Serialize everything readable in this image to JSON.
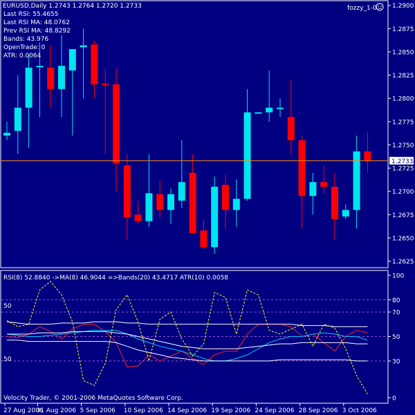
{
  "colors": {
    "background": "#000080",
    "frame": "#ffffff",
    "bull": "#00e5ee",
    "bear": "#ff0000",
    "price_line": "#ff8c1a",
    "rsi": "#ff2020",
    "ma": "#00c8ff",
    "bands": "#ffffff",
    "atr": "#ffff00",
    "levels": "#9a4fd6"
  },
  "header": {
    "symbol_line": "EURUSD,Daily   1.2743 1.2764 1.2720 1.2733",
    "expert_name": "fozzy_1-0",
    "info_lines": [
      "Last RSI: 55.4655",
      "Last RSI MA: 48.0762",
      "Prev RSI MA: 48.8292",
      "Bands: 43.976",
      "OpenTrade: 0",
      "ATR: 0.0064"
    ],
    "current_price_label": "1.2733"
  },
  "indicator": {
    "title": "RSI(8) 52.8840 ->MA(8) 46.9044 =>Bands(20) 43.4717  ATR(10) 0.0058",
    "left_labels": [
      "50",
      "50"
    ],
    "axis_ticks": [
      "100",
      "80",
      "70",
      "50",
      "30",
      "0"
    ]
  },
  "footer": {
    "copyright": "Velocity Trader, © 2001-2006 MetaQuotes Software Corp."
  },
  "chart_data": [
    {
      "type": "candlestick",
      "ylim": [
        1.2618,
        1.2905
      ],
      "y_ticks": [
        "1.2900",
        "1.2875",
        "1.2850",
        "1.2825",
        "1.2800",
        "1.2775",
        "1.2750",
        "1.2725",
        "1.2700",
        "1.2675",
        "1.2650",
        "1.2625"
      ],
      "x_tick_labels": [
        "27 Aug 2006",
        "31 Aug 2006",
        "5 Sep 2006",
        "10 Sep 2006",
        "14 Sep 2006",
        "19 Sep 2006",
        "24 Sep 2006",
        "28 Sep 2006",
        "3 Oct 2006"
      ],
      "current_price": 1.2733,
      "candles": [
        {
          "o": 1.276,
          "h": 1.2775,
          "l": 1.2755,
          "c": 1.2763
        },
        {
          "o": 1.2765,
          "h": 1.2825,
          "l": 1.274,
          "c": 1.279
        },
        {
          "o": 1.279,
          "h": 1.2847,
          "l": 1.2747,
          "c": 1.2833
        },
        {
          "o": 1.2835,
          "h": 1.286,
          "l": 1.278,
          "c": 1.2835
        },
        {
          "o": 1.2833,
          "h": 1.2857,
          "l": 1.279,
          "c": 1.281
        },
        {
          "o": 1.281,
          "h": 1.2868,
          "l": 1.278,
          "c": 1.2835
        },
        {
          "o": 1.283,
          "h": 1.285,
          "l": 1.276,
          "c": 1.2853
        },
        {
          "o": 1.2855,
          "h": 1.2875,
          "l": 1.28,
          "c": 1.2857
        },
        {
          "o": 1.2858,
          "h": 1.2862,
          "l": 1.28,
          "c": 1.2815
        },
        {
          "o": 1.2816,
          "h": 1.2832,
          "l": 1.274,
          "c": 1.2815
        },
        {
          "o": 1.2815,
          "h": 1.2832,
          "l": 1.27,
          "c": 1.273
        },
        {
          "o": 1.2728,
          "h": 1.274,
          "l": 1.2648,
          "c": 1.2672
        },
        {
          "o": 1.2675,
          "h": 1.269,
          "l": 1.2665,
          "c": 1.2668
        },
        {
          "o": 1.2668,
          "h": 1.274,
          "l": 1.2662,
          "c": 1.2698
        },
        {
          "o": 1.2697,
          "h": 1.2712,
          "l": 1.2672,
          "c": 1.268
        },
        {
          "o": 1.268,
          "h": 1.2703,
          "l": 1.2665,
          "c": 1.2697
        },
        {
          "o": 1.269,
          "h": 1.2755,
          "l": 1.2682,
          "c": 1.271
        },
        {
          "o": 1.272,
          "h": 1.274,
          "l": 1.2658,
          "c": 1.2655
        },
        {
          "o": 1.2658,
          "h": 1.267,
          "l": 1.2638,
          "c": 1.264
        },
        {
          "o": 1.264,
          "h": 1.2716,
          "l": 1.2633,
          "c": 1.2705
        },
        {
          "o": 1.2707,
          "h": 1.2718,
          "l": 1.266,
          "c": 1.268
        },
        {
          "o": 1.268,
          "h": 1.2713,
          "l": 1.2662,
          "c": 1.2692
        },
        {
          "o": 1.2692,
          "h": 1.281,
          "l": 1.269,
          "c": 1.2785
        },
        {
          "o": 1.2785,
          "h": 1.2785,
          "l": 1.2785,
          "c": 1.2785
        },
        {
          "o": 1.2785,
          "h": 1.283,
          "l": 1.2775,
          "c": 1.279
        },
        {
          "o": 1.279,
          "h": 1.28,
          "l": 1.278,
          "c": 1.279
        },
        {
          "o": 1.278,
          "h": 1.282,
          "l": 1.274,
          "c": 1.2755
        },
        {
          "o": 1.2755,
          "h": 1.276,
          "l": 1.266,
          "c": 1.2695
        },
        {
          "o": 1.2695,
          "h": 1.272,
          "l": 1.2675,
          "c": 1.271
        },
        {
          "o": 1.271,
          "h": 1.2728,
          "l": 1.2698,
          "c": 1.2705
        },
        {
          "o": 1.2705,
          "h": 1.272,
          "l": 1.2648,
          "c": 1.267
        },
        {
          "o": 1.2673,
          "h": 1.2686,
          "l": 1.267,
          "c": 1.268
        },
        {
          "o": 1.268,
          "h": 1.276,
          "l": 1.266,
          "c": 1.2743
        },
        {
          "o": 1.2743,
          "h": 1.2764,
          "l": 1.272,
          "c": 1.2733
        }
      ]
    },
    {
      "type": "line",
      "ylim": [
        0,
        100
      ],
      "levels": [
        80,
        70,
        50,
        30
      ],
      "series": [
        {
          "name": "RSI(8)",
          "values": [
            50,
            49,
            52,
            58,
            54,
            48,
            56,
            60,
            60,
            54,
            45,
            25,
            26,
            35,
            30,
            34,
            38,
            32,
            27,
            35,
            38,
            38,
            52,
            60,
            60,
            60,
            58,
            50,
            52,
            45,
            38,
            50,
            55,
            53
          ]
        },
        {
          "name": "MA(8)",
          "values": [
            52,
            51,
            50,
            50,
            51,
            52,
            53,
            54,
            55,
            55,
            55,
            52,
            48,
            45,
            42,
            40,
            38,
            35,
            32,
            30,
            30,
            32,
            35,
            40,
            45,
            48,
            50,
            50,
            52,
            53,
            52,
            50,
            50,
            47
          ]
        },
        {
          "name": "Bands upper",
          "values": [
            62,
            61,
            60,
            60,
            60,
            61,
            61,
            61,
            62,
            62,
            62,
            61,
            61,
            60,
            60,
            60,
            60,
            60,
            60,
            60,
            60,
            60,
            60,
            60,
            60,
            60,
            60,
            59,
            59,
            59,
            58,
            58,
            58,
            58
          ]
        },
        {
          "name": "Bands middle",
          "values": [
            52,
            52,
            52,
            53,
            53,
            53,
            54,
            54,
            54,
            54,
            53,
            52,
            50,
            48,
            46,
            44,
            42,
            41,
            40,
            40,
            40,
            40,
            41,
            42,
            43,
            44,
            44,
            45,
            45,
            45,
            45,
            45,
            44,
            44
          ]
        },
        {
          "name": "Bands lower",
          "values": [
            47,
            47,
            46,
            46,
            46,
            46,
            46,
            46,
            46,
            46,
            45,
            42,
            39,
            37,
            35,
            33,
            32,
            31,
            30,
            30,
            30,
            30,
            30,
            30,
            30,
            31,
            31,
            31,
            31,
            31,
            31,
            31,
            30,
            30
          ]
        },
        {
          "name": "ATR(10)",
          "values": [
            63,
            58,
            60,
            88,
            95,
            84,
            62,
            14,
            10,
            28,
            72,
            84,
            62,
            30,
            64,
            70,
            48,
            34,
            44,
            86,
            82,
            52,
            88,
            84,
            55,
            52,
            56,
            60,
            42,
            60,
            57,
            40,
            18,
            3
          ]
        }
      ]
    }
  ]
}
